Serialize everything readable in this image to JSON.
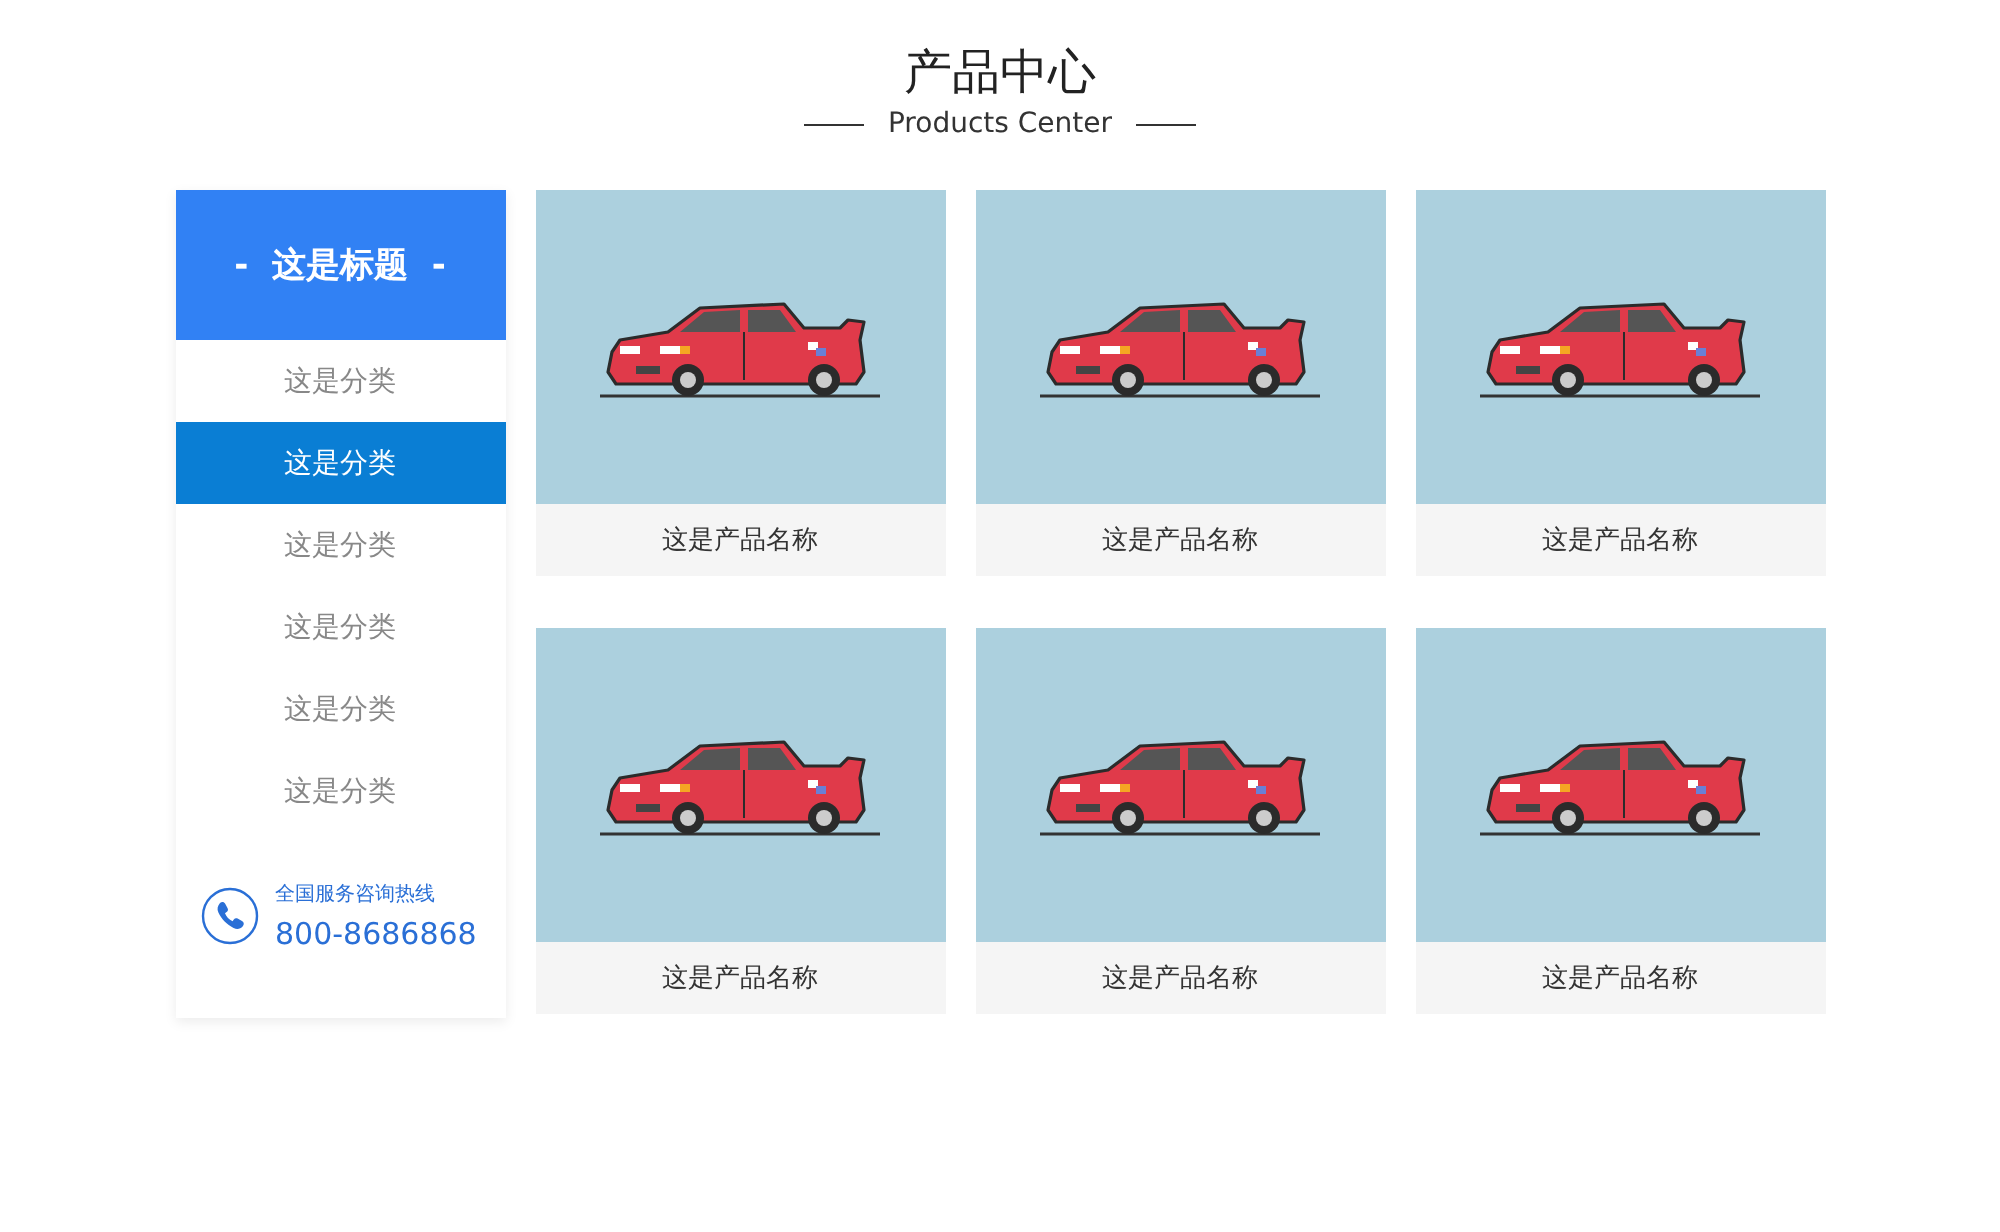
{
  "heading": {
    "title": "产品中心",
    "subtitle": "Products Center"
  },
  "sidebar": {
    "title": "-  这是标题  -",
    "categories": [
      {
        "label": "这是分类",
        "selected": false
      },
      {
        "label": "这是分类",
        "selected": true
      },
      {
        "label": "这是分类",
        "selected": false
      },
      {
        "label": "这是分类",
        "selected": false
      },
      {
        "label": "这是分类",
        "selected": false
      },
      {
        "label": "这是分类",
        "selected": false
      }
    ],
    "hotline": {
      "label": "全国服务咨询热线",
      "number": "800-8686868"
    }
  },
  "products": [
    {
      "name": "这是产品名称"
    },
    {
      "name": "这是产品名称"
    },
    {
      "name": "这是产品名称"
    },
    {
      "name": "这是产品名称"
    },
    {
      "name": "这是产品名称"
    },
    {
      "name": "这是产品名称"
    }
  ]
}
